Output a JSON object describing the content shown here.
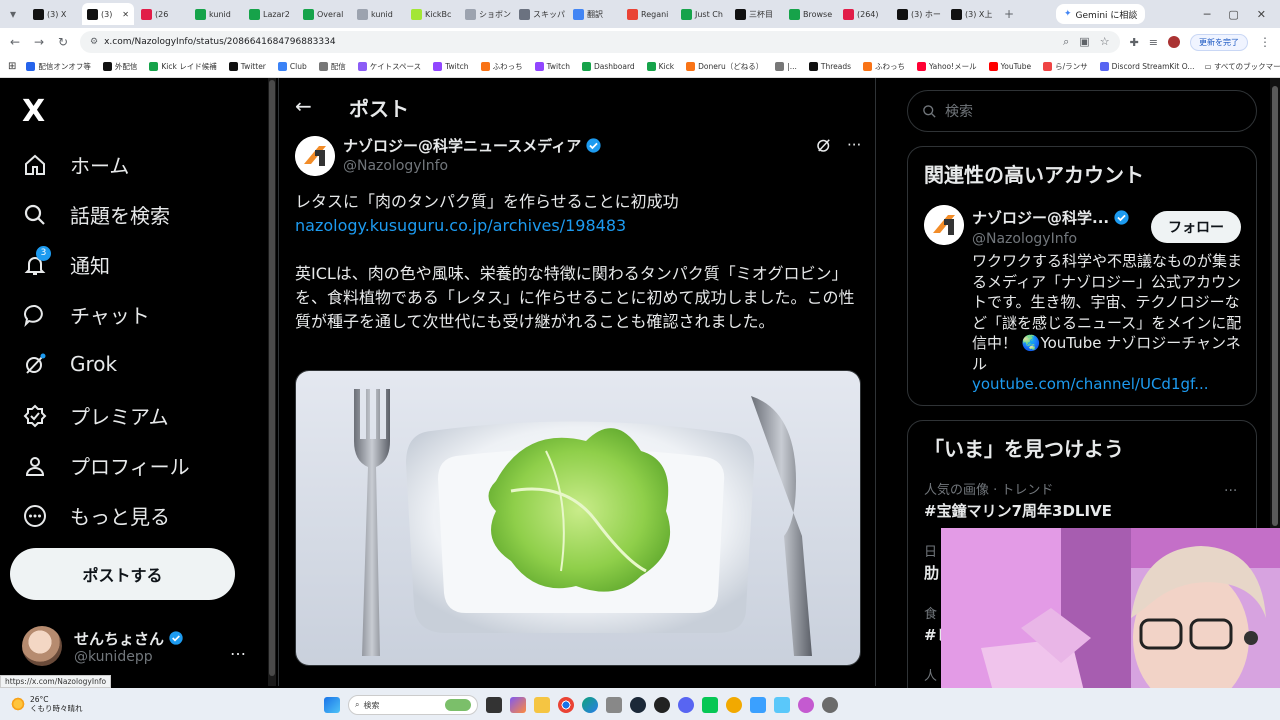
{
  "browser": {
    "tabs": [
      {
        "label": "(3) X",
        "color": "#111111"
      },
      {
        "label": "(3)",
        "color": "#111111",
        "active": true
      },
      {
        "label": "(26",
        "color": "#e11d48"
      },
      {
        "label": "kunid",
        "color": "#16a34a"
      },
      {
        "label": "Lazar2",
        "color": "#16a34a"
      },
      {
        "label": "Overal",
        "color": "#16a34a"
      },
      {
        "label": "kunid",
        "color": "#9ca3af"
      },
      {
        "label": "KickBc",
        "color": "#a3e635"
      },
      {
        "label": "ショボン",
        "color": "#9ca3af"
      },
      {
        "label": "スキッパ",
        "color": "#6b7280"
      },
      {
        "label": "翻訳 ",
        "color": "#4285f4"
      },
      {
        "label": "Regani",
        "color": "#ea4335"
      },
      {
        "label": "Just Ch",
        "color": "#16a34a"
      },
      {
        "label": "三杯目",
        "color": "#111111"
      },
      {
        "label": "Browse",
        "color": "#16a34a"
      },
      {
        "label": "(264)",
        "color": "#e11d48"
      },
      {
        "label": "(3) ホー",
        "color": "#111111"
      },
      {
        "label": "(3) X上",
        "color": "#111111"
      }
    ],
    "gemini_tab": "Gemini に相談",
    "url": "x.com/NazologyInfo/status/2086641684796883334",
    "update_label": "更新を完了",
    "bookmarks": [
      "配信オンオフ等",
      "外配信",
      "Kick レイド候補",
      "Twitter",
      "Club",
      "配信",
      "ケイトスペース",
      "Twitch",
      "ふわっち",
      "Twitch",
      "Dashboard",
      "Kick",
      "Doneru（どねる）",
      "|...",
      "Threads",
      "ふわっち",
      "Yahoo!メール",
      "YouTube",
      "ら/ランサ",
      "Discord StreamKit O..."
    ],
    "all_bookmarks": "すべてのブックマーク"
  },
  "nav": {
    "logo": "X",
    "items": [
      {
        "label": "ホーム",
        "icon": "home-icon"
      },
      {
        "label": "話題を検索",
        "icon": "search-icon"
      },
      {
        "label": "通知",
        "icon": "bell-icon",
        "badge": "3"
      },
      {
        "label": "チャット",
        "icon": "chat-icon"
      },
      {
        "label": "Grok",
        "icon": "grok-icon"
      },
      {
        "label": "プレミアム",
        "icon": "premium-icon"
      },
      {
        "label": "プロフィール",
        "icon": "profile-icon"
      },
      {
        "label": "もっと見る",
        "icon": "more-icon"
      }
    ],
    "post_button": "ポストする",
    "user": {
      "name": "せんちょさん",
      "handle": "@kunidepp",
      "more": "…"
    }
  },
  "main": {
    "title": "ポスト",
    "author": {
      "name": "ナゾロジー@科学ニュースメディア",
      "handle": "@NazologyInfo"
    },
    "text_line1": "レタスに「肉のタンパク質」を作らせることに初成功",
    "link": "nazology.kusuguru.co.jp/archives/198483",
    "text_body": "英ICLは、肉の色や風味、栄養的な特徴に関わるタンパク質「ミオグロビン」を、食料植物である「レタス」に作らせることに初めて成功しました。この性質が種子を通して次世代にも受け継がれることも確認されました。"
  },
  "right": {
    "search_placeholder": "検索",
    "related_title": "関連性の高いアカウント",
    "related": {
      "name": "ナゾロジー@科学...",
      "handle": "@NazologyInfo",
      "follow": "フォロー",
      "bio": "ワクワクする科学や不思議なものが集まるメディア「ナゾロジー」公式アカウントです。生き物、宇宙、テクノロジーなど「謎を感じるニュース」をメインに配信中！ 🌏YouTube ナゾロジーチャンネル",
      "link": "youtube.com/channel/UCd1gf..."
    },
    "trends_title": "「いま」を見つけよう",
    "trends": [
      {
        "meta": "人気の画像 · トレンド",
        "name": "#宝鐘マリン7周年3DLIVE"
      },
      {
        "meta": "日",
        "name": "肋"
      },
      {
        "meta": "食",
        "name": "#レ"
      },
      {
        "meta": "人",
        "name": ""
      }
    ]
  },
  "status_url": "https://x.com/NazologyInfo",
  "taskbar": {
    "temp": "26°C",
    "weather": "くもり時々晴れ",
    "search": "検索"
  }
}
